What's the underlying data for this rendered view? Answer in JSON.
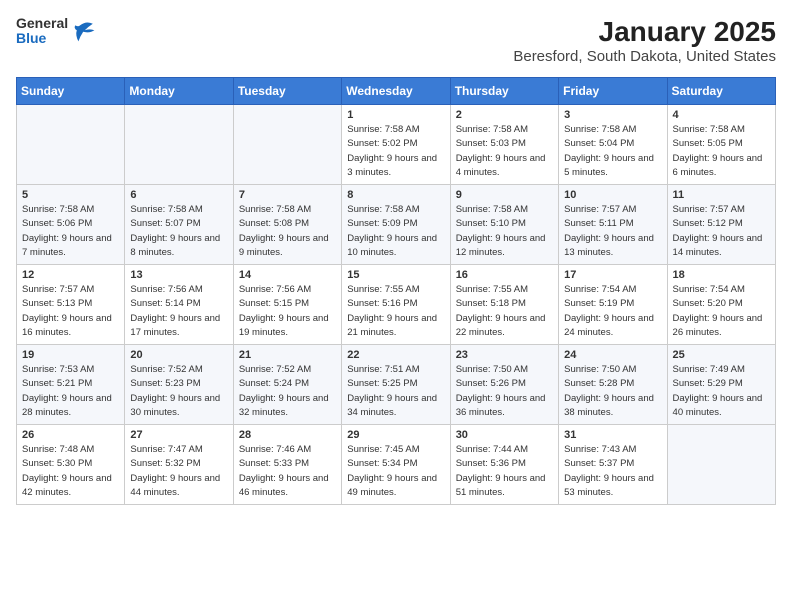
{
  "header": {
    "logo": {
      "general": "General",
      "blue": "Blue"
    },
    "title": "January 2025",
    "subtitle": "Beresford, South Dakota, United States"
  },
  "weekdays": [
    "Sunday",
    "Monday",
    "Tuesday",
    "Wednesday",
    "Thursday",
    "Friday",
    "Saturday"
  ],
  "weeks": [
    [
      {
        "day": "",
        "sunrise": "",
        "sunset": "",
        "daylight": ""
      },
      {
        "day": "",
        "sunrise": "",
        "sunset": "",
        "daylight": ""
      },
      {
        "day": "",
        "sunrise": "",
        "sunset": "",
        "daylight": ""
      },
      {
        "day": "1",
        "sunrise": "Sunrise: 7:58 AM",
        "sunset": "Sunset: 5:02 PM",
        "daylight": "Daylight: 9 hours and 3 minutes."
      },
      {
        "day": "2",
        "sunrise": "Sunrise: 7:58 AM",
        "sunset": "Sunset: 5:03 PM",
        "daylight": "Daylight: 9 hours and 4 minutes."
      },
      {
        "day": "3",
        "sunrise": "Sunrise: 7:58 AM",
        "sunset": "Sunset: 5:04 PM",
        "daylight": "Daylight: 9 hours and 5 minutes."
      },
      {
        "day": "4",
        "sunrise": "Sunrise: 7:58 AM",
        "sunset": "Sunset: 5:05 PM",
        "daylight": "Daylight: 9 hours and 6 minutes."
      }
    ],
    [
      {
        "day": "5",
        "sunrise": "Sunrise: 7:58 AM",
        "sunset": "Sunset: 5:06 PM",
        "daylight": "Daylight: 9 hours and 7 minutes."
      },
      {
        "day": "6",
        "sunrise": "Sunrise: 7:58 AM",
        "sunset": "Sunset: 5:07 PM",
        "daylight": "Daylight: 9 hours and 8 minutes."
      },
      {
        "day": "7",
        "sunrise": "Sunrise: 7:58 AM",
        "sunset": "Sunset: 5:08 PM",
        "daylight": "Daylight: 9 hours and 9 minutes."
      },
      {
        "day": "8",
        "sunrise": "Sunrise: 7:58 AM",
        "sunset": "Sunset: 5:09 PM",
        "daylight": "Daylight: 9 hours and 10 minutes."
      },
      {
        "day": "9",
        "sunrise": "Sunrise: 7:58 AM",
        "sunset": "Sunset: 5:10 PM",
        "daylight": "Daylight: 9 hours and 12 minutes."
      },
      {
        "day": "10",
        "sunrise": "Sunrise: 7:57 AM",
        "sunset": "Sunset: 5:11 PM",
        "daylight": "Daylight: 9 hours and 13 minutes."
      },
      {
        "day": "11",
        "sunrise": "Sunrise: 7:57 AM",
        "sunset": "Sunset: 5:12 PM",
        "daylight": "Daylight: 9 hours and 14 minutes."
      }
    ],
    [
      {
        "day": "12",
        "sunrise": "Sunrise: 7:57 AM",
        "sunset": "Sunset: 5:13 PM",
        "daylight": "Daylight: 9 hours and 16 minutes."
      },
      {
        "day": "13",
        "sunrise": "Sunrise: 7:56 AM",
        "sunset": "Sunset: 5:14 PM",
        "daylight": "Daylight: 9 hours and 17 minutes."
      },
      {
        "day": "14",
        "sunrise": "Sunrise: 7:56 AM",
        "sunset": "Sunset: 5:15 PM",
        "daylight": "Daylight: 9 hours and 19 minutes."
      },
      {
        "day": "15",
        "sunrise": "Sunrise: 7:55 AM",
        "sunset": "Sunset: 5:16 PM",
        "daylight": "Daylight: 9 hours and 21 minutes."
      },
      {
        "day": "16",
        "sunrise": "Sunrise: 7:55 AM",
        "sunset": "Sunset: 5:18 PM",
        "daylight": "Daylight: 9 hours and 22 minutes."
      },
      {
        "day": "17",
        "sunrise": "Sunrise: 7:54 AM",
        "sunset": "Sunset: 5:19 PM",
        "daylight": "Daylight: 9 hours and 24 minutes."
      },
      {
        "day": "18",
        "sunrise": "Sunrise: 7:54 AM",
        "sunset": "Sunset: 5:20 PM",
        "daylight": "Daylight: 9 hours and 26 minutes."
      }
    ],
    [
      {
        "day": "19",
        "sunrise": "Sunrise: 7:53 AM",
        "sunset": "Sunset: 5:21 PM",
        "daylight": "Daylight: 9 hours and 28 minutes."
      },
      {
        "day": "20",
        "sunrise": "Sunrise: 7:52 AM",
        "sunset": "Sunset: 5:23 PM",
        "daylight": "Daylight: 9 hours and 30 minutes."
      },
      {
        "day": "21",
        "sunrise": "Sunrise: 7:52 AM",
        "sunset": "Sunset: 5:24 PM",
        "daylight": "Daylight: 9 hours and 32 minutes."
      },
      {
        "day": "22",
        "sunrise": "Sunrise: 7:51 AM",
        "sunset": "Sunset: 5:25 PM",
        "daylight": "Daylight: 9 hours and 34 minutes."
      },
      {
        "day": "23",
        "sunrise": "Sunrise: 7:50 AM",
        "sunset": "Sunset: 5:26 PM",
        "daylight": "Daylight: 9 hours and 36 minutes."
      },
      {
        "day": "24",
        "sunrise": "Sunrise: 7:50 AM",
        "sunset": "Sunset: 5:28 PM",
        "daylight": "Daylight: 9 hours and 38 minutes."
      },
      {
        "day": "25",
        "sunrise": "Sunrise: 7:49 AM",
        "sunset": "Sunset: 5:29 PM",
        "daylight": "Daylight: 9 hours and 40 minutes."
      }
    ],
    [
      {
        "day": "26",
        "sunrise": "Sunrise: 7:48 AM",
        "sunset": "Sunset: 5:30 PM",
        "daylight": "Daylight: 9 hours and 42 minutes."
      },
      {
        "day": "27",
        "sunrise": "Sunrise: 7:47 AM",
        "sunset": "Sunset: 5:32 PM",
        "daylight": "Daylight: 9 hours and 44 minutes."
      },
      {
        "day": "28",
        "sunrise": "Sunrise: 7:46 AM",
        "sunset": "Sunset: 5:33 PM",
        "daylight": "Daylight: 9 hours and 46 minutes."
      },
      {
        "day": "29",
        "sunrise": "Sunrise: 7:45 AM",
        "sunset": "Sunset: 5:34 PM",
        "daylight": "Daylight: 9 hours and 49 minutes."
      },
      {
        "day": "30",
        "sunrise": "Sunrise: 7:44 AM",
        "sunset": "Sunset: 5:36 PM",
        "daylight": "Daylight: 9 hours and 51 minutes."
      },
      {
        "day": "31",
        "sunrise": "Sunrise: 7:43 AM",
        "sunset": "Sunset: 5:37 PM",
        "daylight": "Daylight: 9 hours and 53 minutes."
      },
      {
        "day": "",
        "sunrise": "",
        "sunset": "",
        "daylight": ""
      }
    ]
  ]
}
